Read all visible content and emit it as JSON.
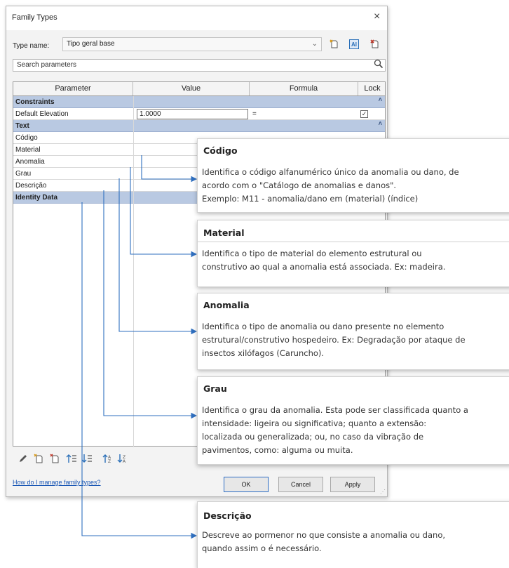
{
  "dialog": {
    "title": "Family Types",
    "close_glyph": "×",
    "type_name_label": "Type name:",
    "type_name_value": "Tipo geral base",
    "dropdown_glyph": "⌄",
    "search_placeholder": "Search parameters",
    "columns": {
      "parameter": "Parameter",
      "value": "Value",
      "formula": "Formula",
      "lock": "Lock"
    },
    "groups": {
      "constraints": "Constraints",
      "text": "Text",
      "identity": "Identity Data"
    },
    "collapse_glyph": "˄",
    "rows": {
      "default_elevation": {
        "name": "Default Elevation",
        "value": "1.0000",
        "formula": "=",
        "locked": "✓"
      },
      "text_params": [
        "Código",
        "Material",
        "Anomalia",
        "Grau",
        "Descrição"
      ]
    },
    "help_link": "How do I manage family types?",
    "buttons": {
      "ok": "OK",
      "cancel": "Cancel",
      "apply": "Apply"
    },
    "icons": [
      "pencil-icon",
      "new-parameter-icon",
      "delete-parameter-icon",
      "move-up-icon",
      "move-down-icon",
      "sort-ascending-icon",
      "sort-descending-icon"
    ]
  },
  "callouts": {
    "codigo": {
      "title": "Código",
      "desc": "Identifica o código alfanumérico único da anomalia ou dano, de\nacordo com o \"Catálogo de anomalias e danos\".\n Exemplo: M11 - anomalia/dano em (material) (índice)"
    },
    "material": {
      "title": "Material",
      "desc": "Identifica o tipo de material do elemento estrutural ou\nconstrutivo ao qual a anomalia está associada. Ex: madeira."
    },
    "anomalia": {
      "title": "Anomalia",
      "desc": "Identifica o tipo de anomalia ou dano presente no elemento\nestrutural/construtivo hospedeiro. Ex: Degradação por ataque de\ninsectos xilófagos (Caruncho)."
    },
    "grau": {
      "title": "Grau",
      "desc": "Identifica o grau da anomalia. Esta pode ser classificada quanto a\nintensidade: ligeira ou significativa;  quanto a extensão:\nlocalizada ou generalizada; ou, no caso da vibração de\npavimentos, como: alguma ou muita."
    },
    "descricao": {
      "title": "Descrição",
      "desc": "Descreve ao pormenor no que consiste a anomalia ou dano,\nquando assim o é necessário."
    }
  },
  "colors": {
    "group_header": "#b9c9e2",
    "arrow": "#2f6fbf",
    "link": "#1a57b5"
  }
}
